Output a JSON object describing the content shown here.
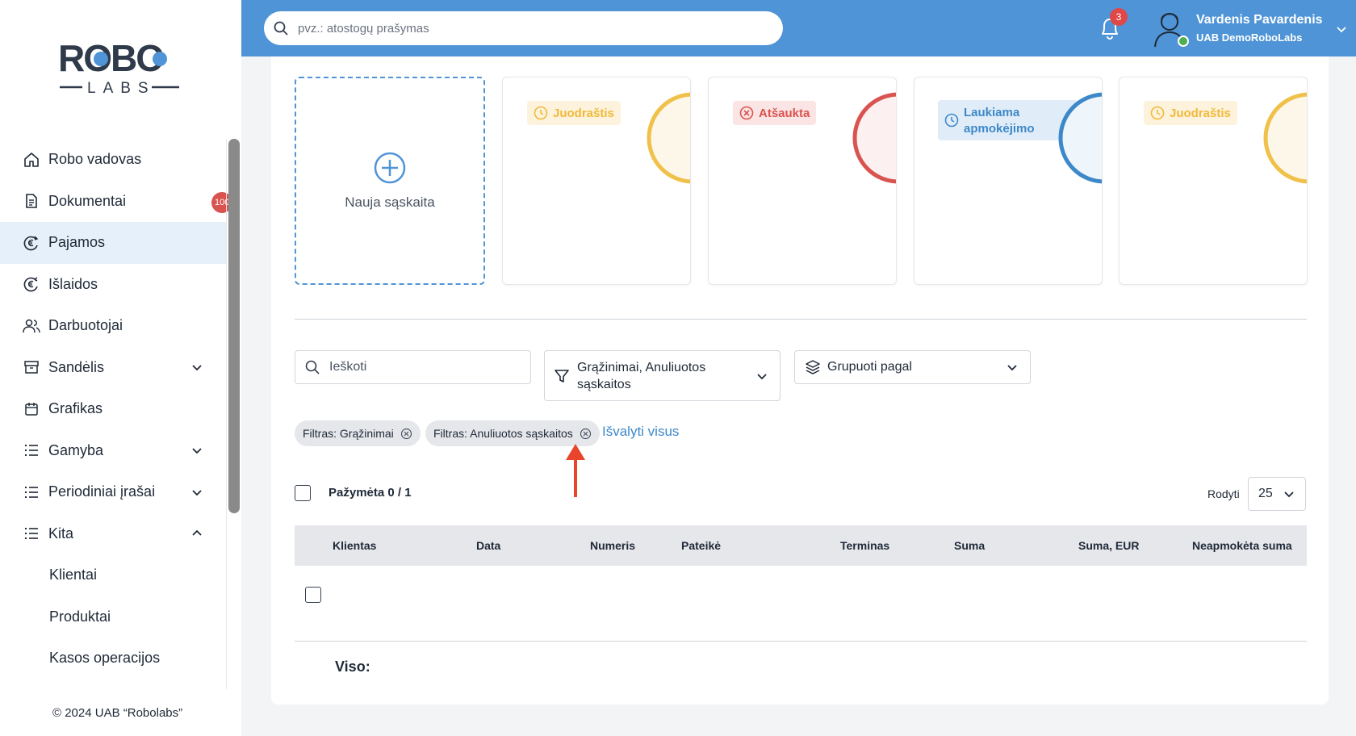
{
  "brand": {
    "logo_top": "ROBO",
    "logo_bottom": "LABS"
  },
  "header": {
    "search_placeholder": "pvz.: atostogų prašymas",
    "notifications_count": "3",
    "user_name": "Vardenis Pavardenis",
    "user_company": "UAB DemoRoboLabs"
  },
  "sidebar": {
    "items": [
      {
        "label": "Robo vadovas",
        "icon": "home-icon"
      },
      {
        "label": "Dokumentai",
        "icon": "document-icon",
        "badge": "100"
      },
      {
        "label": "Pajamos",
        "icon": "euro-in-icon",
        "active": true
      },
      {
        "label": "Išlaidos",
        "icon": "euro-out-icon"
      },
      {
        "label": "Darbuotojai",
        "icon": "users-icon"
      },
      {
        "label": "Sandėlis",
        "icon": "warehouse-icon",
        "expand": "down"
      },
      {
        "label": "Grafikas",
        "icon": "calendar-icon"
      },
      {
        "label": "Gamyba",
        "icon": "list-icon",
        "expand": "down"
      },
      {
        "label": "Periodiniai įrašai",
        "icon": "list-icon",
        "expand": "down"
      },
      {
        "label": "Kita",
        "icon": "list-icon",
        "expand": "up"
      }
    ],
    "subitems": [
      "Klientai",
      "Produktai",
      "Kasos operacijos"
    ],
    "copyright": "© 2024 UAB “Robolabs”"
  },
  "cards": {
    "new_label": "Nauja sąskaita",
    "statuses": [
      {
        "label": "Juodraštis",
        "color": "#f0b93a"
      },
      {
        "label": "Atšaukta",
        "color": "#d9534f"
      },
      {
        "label": "Laukiama apmokėjimo",
        "color": "#3d88c9"
      },
      {
        "label": "Juodraštis",
        "color": "#f0b93a"
      }
    ]
  },
  "filters": {
    "search_placeholder": "Ieškoti",
    "filter_value": "Grąžinimai, Anuliuotos sąskaitos",
    "group_label": "Grupuoti pagal",
    "chips": [
      "Filtras: Grąžinimai",
      "Filtras: Anuliuotos sąskaitos"
    ],
    "clear_all": "Išvalyti visus"
  },
  "table": {
    "selected": "Pažymėta 0 / 1",
    "show_label": "Rodyti",
    "page_size": "25",
    "columns": [
      "Klientas",
      "Data",
      "Numeris",
      "Pateikė",
      "Terminas",
      "Suma",
      "Suma, EUR",
      "Neapmokėta suma"
    ],
    "total_label": "Viso:"
  }
}
